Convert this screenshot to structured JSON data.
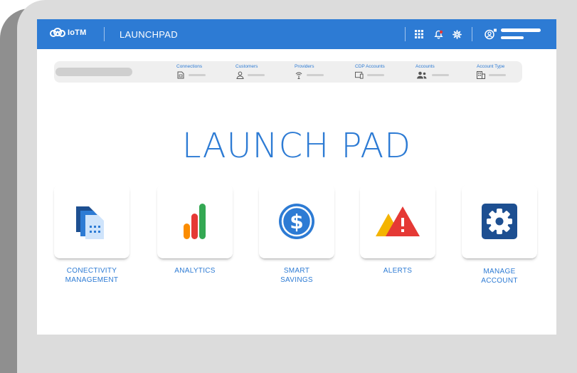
{
  "header": {
    "logo_text": "IoTM",
    "app_title": "LAUNCHPAD"
  },
  "stats": [
    {
      "label": "Connections",
      "icon": "sim-card-icon"
    },
    {
      "label": "Customers",
      "icon": "person-icon"
    },
    {
      "label": "Providers",
      "icon": "antenna-icon"
    },
    {
      "label": "CDP Accounts",
      "icon": "devices-icon"
    },
    {
      "label": "Accounts",
      "icon": "group-icon"
    },
    {
      "label": "Account Type",
      "icon": "building-icon"
    }
  ],
  "main": {
    "title": "LAUNCH PAD",
    "tiles": [
      {
        "label_line1": "CONECTIVITY",
        "label_line2": "MANAGEMENT",
        "icon": "sim-cards-icon"
      },
      {
        "label_line1": "ANALYTICS",
        "label_line2": "",
        "icon": "bar-chart-icon"
      },
      {
        "label_line1": "SMART",
        "label_line2": "SAVINGS",
        "icon": "dollar-coin-icon"
      },
      {
        "label_line1": "ALERTS",
        "label_line2": "",
        "icon": "warning-triangles-icon"
      },
      {
        "label_line1": "MANAGE",
        "label_line2": "ACCOUNT",
        "icon": "gear-icon"
      }
    ]
  },
  "colors": {
    "primary": "#2d7bd4",
    "alert_red": "#e53935",
    "alert_yellow": "#f4b400",
    "chart_green": "#34a853",
    "chart_orange": "#fb8c00",
    "manage_dark_blue": "#1d4f91"
  }
}
